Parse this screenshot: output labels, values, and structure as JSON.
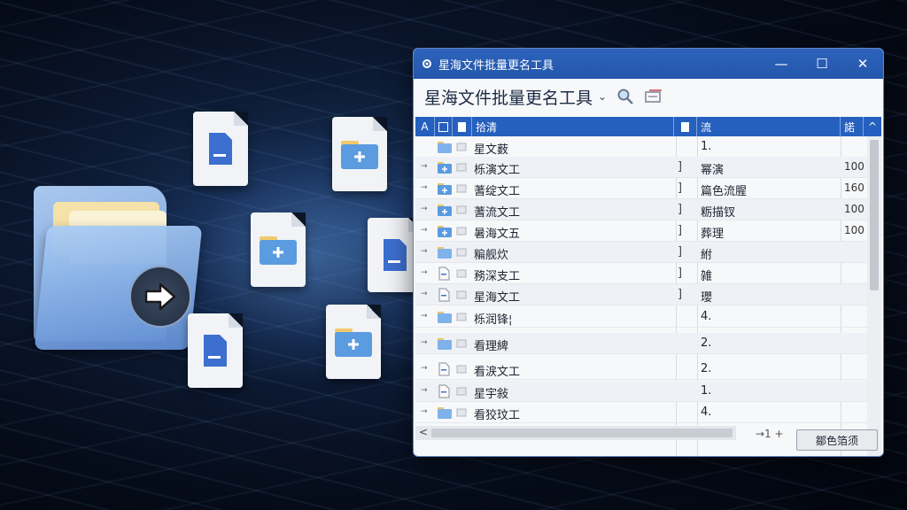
{
  "window": {
    "title": "星海文件批量更名工具",
    "minimize_glyph": "—",
    "maximize_glyph": "☐",
    "close_glyph": "✕"
  },
  "toolbar": {
    "heading": "星海文件批量更名工具",
    "dropdown_glyph": "⌄"
  },
  "table": {
    "headers": {
      "col_a": "A",
      "name": "拾清",
      "value": "流",
      "count": "諾"
    },
    "rows": [
      {
        "name": "星文薮",
        "sep": "",
        "val": "1.",
        "num": "",
        "icon": "folder-icon"
      },
      {
        "name": "栎演文工",
        "sep": "]",
        "val": "幂演",
        "num": "100",
        "icon": "folder-plus-icon"
      },
      {
        "name": "蓍绽文工",
        "sep": "]",
        "val": "篇色流腥",
        "num": "160",
        "icon": "folder-plus-icon"
      },
      {
        "name": "蓍流文工",
        "sep": "]",
        "val": "粝描钗",
        "num": "100",
        "icon": "folder-plus-icon"
      },
      {
        "name": "暑海文五",
        "sep": "]",
        "val": "葬理",
        "num": "100",
        "icon": "folder-plus-icon"
      },
      {
        "name": "糄舰炊",
        "sep": "]",
        "val": "紨",
        "num": "",
        "icon": "folder-icon"
      },
      {
        "name": "務深支工",
        "sep": "]",
        "val": "雑",
        "num": "",
        "icon": "document-icon"
      },
      {
        "name": "星海文工",
        "sep": "]",
        "val": "瓔",
        "num": "",
        "icon": "document-icon"
      },
      {
        "name": "栎润锋¦",
        "sep": "",
        "val": "4.",
        "num": "",
        "icon": "folder-icon"
      },
      {
        "name": "看理綼",
        "sep": "",
        "val": "2.",
        "num": "",
        "icon": "folder-icon"
      },
      {
        "name": "看涙文工",
        "sep": "",
        "val": "2.",
        "num": "",
        "icon": "document-icon"
      },
      {
        "name": "星宇敍",
        "sep": "",
        "val": "1.",
        "num": "",
        "icon": "document-icon"
      },
      {
        "name": "看狡玟工",
        "sep": "",
        "val": "4.",
        "num": "",
        "icon": "folder-icon"
      }
    ]
  },
  "footer": {
    "scroll_left_glyph": "<",
    "pager_text": "→1 +",
    "action_button": "鄒色箔须",
    "scroll_down_glyph": "⌄"
  },
  "colors": {
    "titlebar": "#2457aa",
    "header_row": "#2660bf",
    "folder_blue": "#5b9be0",
    "document_blue": "#3c6fcf"
  }
}
